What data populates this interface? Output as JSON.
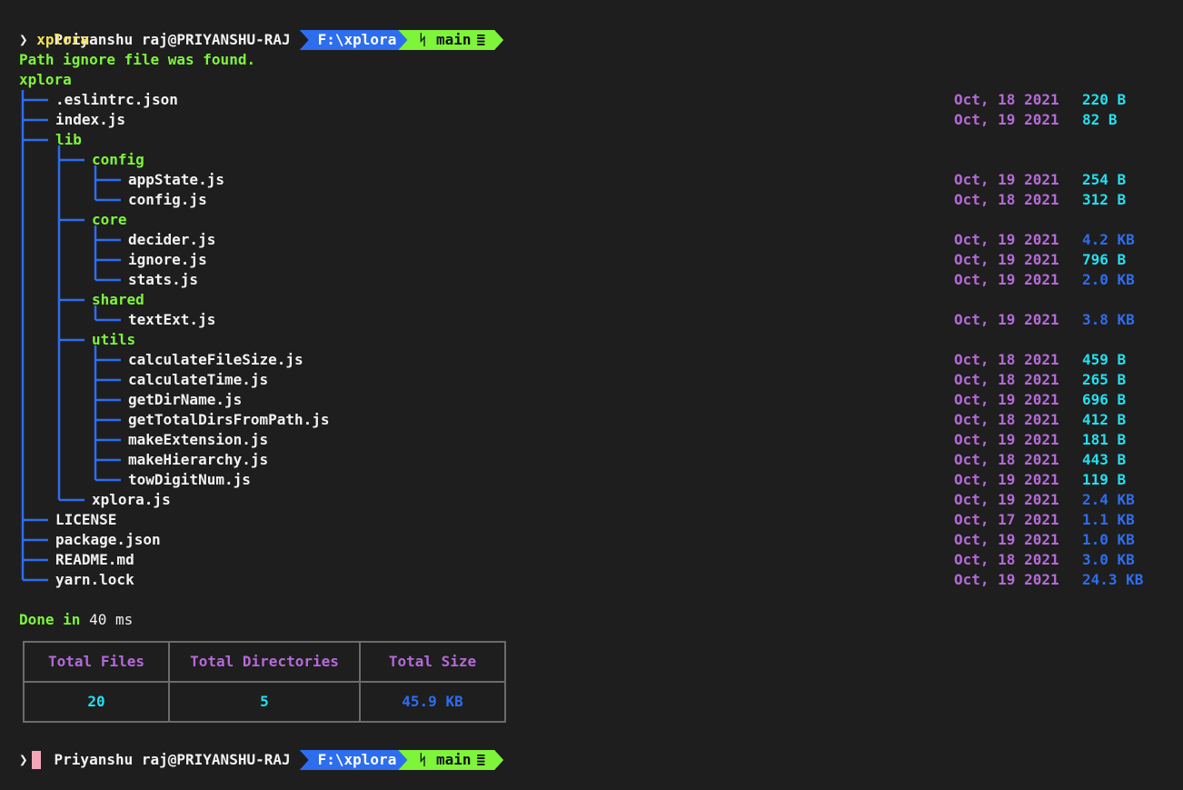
{
  "prompt": {
    "user": "Priyanshu raj@PRIYANSHU-RAJ",
    "path": "F:\\xplora",
    "branch_glyph": "ᛋ",
    "branch": "main",
    "status_glyph": "≣",
    "chevron": "❯"
  },
  "command": "xplora",
  "message": "Path ignore file was found.",
  "root": "xplora",
  "tree": [
    {
      "name": ".eslintrc.json",
      "depth": 0,
      "type": "file",
      "date": "Oct, 18 2021",
      "size": "220 B",
      "unit": "B"
    },
    {
      "name": "index.js",
      "depth": 0,
      "type": "file",
      "date": "Oct, 19 2021",
      "size": "82 B",
      "unit": "B"
    },
    {
      "name": "lib",
      "depth": 0,
      "type": "dir"
    },
    {
      "name": "config",
      "depth": 1,
      "type": "dir"
    },
    {
      "name": "appState.js",
      "depth": 2,
      "type": "file",
      "date": "Oct, 19 2021",
      "size": "254 B",
      "unit": "B"
    },
    {
      "name": "config.js",
      "depth": 2,
      "type": "file",
      "date": "Oct, 18 2021",
      "size": "312 B",
      "unit": "B"
    },
    {
      "name": "core",
      "depth": 1,
      "type": "dir"
    },
    {
      "name": "decider.js",
      "depth": 2,
      "type": "file",
      "date": "Oct, 19 2021",
      "size": "4.2 KB",
      "unit": "KB"
    },
    {
      "name": "ignore.js",
      "depth": 2,
      "type": "file",
      "date": "Oct, 19 2021",
      "size": "796 B",
      "unit": "B"
    },
    {
      "name": "stats.js",
      "depth": 2,
      "type": "file",
      "date": "Oct, 19 2021",
      "size": "2.0 KB",
      "unit": "KB"
    },
    {
      "name": "shared",
      "depth": 1,
      "type": "dir"
    },
    {
      "name": "textExt.js",
      "depth": 2,
      "type": "file",
      "date": "Oct, 19 2021",
      "size": "3.8 KB",
      "unit": "KB"
    },
    {
      "name": "utils",
      "depth": 1,
      "type": "dir"
    },
    {
      "name": "calculateFileSize.js",
      "depth": 2,
      "type": "file",
      "date": "Oct, 18 2021",
      "size": "459 B",
      "unit": "B"
    },
    {
      "name": "calculateTime.js",
      "depth": 2,
      "type": "file",
      "date": "Oct, 18 2021",
      "size": "265 B",
      "unit": "B"
    },
    {
      "name": "getDirName.js",
      "depth": 2,
      "type": "file",
      "date": "Oct, 19 2021",
      "size": "696 B",
      "unit": "B"
    },
    {
      "name": "getTotalDirsFromPath.js",
      "depth": 2,
      "type": "file",
      "date": "Oct, 18 2021",
      "size": "412 B",
      "unit": "B"
    },
    {
      "name": "makeExtension.js",
      "depth": 2,
      "type": "file",
      "date": "Oct, 19 2021",
      "size": "181 B",
      "unit": "B"
    },
    {
      "name": "makeHierarchy.js",
      "depth": 2,
      "type": "file",
      "date": "Oct, 18 2021",
      "size": "443 B",
      "unit": "B"
    },
    {
      "name": "towDigitNum.js",
      "depth": 2,
      "type": "file",
      "date": "Oct, 19 2021",
      "size": "119 B",
      "unit": "B"
    },
    {
      "name": "xplora.js",
      "depth": 1,
      "type": "file",
      "date": "Oct, 19 2021",
      "size": "2.4 KB",
      "unit": "KB"
    },
    {
      "name": "LICENSE",
      "depth": 0,
      "type": "file",
      "date": "Oct, 17 2021",
      "size": "1.1 KB",
      "unit": "KB"
    },
    {
      "name": "package.json",
      "depth": 0,
      "type": "file",
      "date": "Oct, 19 2021",
      "size": "1.0 KB",
      "unit": "KB"
    },
    {
      "name": "README.md",
      "depth": 0,
      "type": "file",
      "date": "Oct, 18 2021",
      "size": "3.0 KB",
      "unit": "KB"
    },
    {
      "name": "yarn.lock",
      "depth": 0,
      "type": "file",
      "date": "Oct, 19 2021",
      "size": "24.3 KB",
      "unit": "KB"
    }
  ],
  "done": {
    "label": "Done in",
    "value": "40 ms"
  },
  "stats": {
    "headers": [
      "Total Files",
      "Total Directories",
      "Total Size"
    ],
    "values": [
      "20",
      "5",
      "45.9 KB"
    ]
  },
  "colors": {
    "background": "#1e1e1e",
    "path_segment": "#2d6df0",
    "git_segment": "#7ef53b",
    "directory": "#7ef53b",
    "date": "#b56ad9",
    "size_bytes": "#22e0f0",
    "size_kb": "#2d6df0",
    "tree_lines": "#2d6df0",
    "cursor": "#f4a7b9"
  }
}
